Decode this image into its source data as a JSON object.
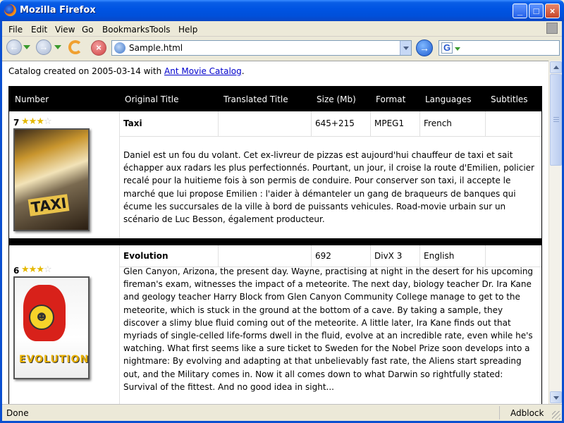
{
  "window": {
    "title": "Mozilla Firefox",
    "buttons": {
      "minimize": "_",
      "maximize": "□",
      "close": "×"
    }
  },
  "menubar": {
    "items": [
      "File",
      "Edit",
      "View",
      "Go",
      "Bookmarks",
      "Tools",
      "Help"
    ]
  },
  "toolbar": {
    "url": "Sample.html",
    "search_engine_icon": "G",
    "search_value": ""
  },
  "page": {
    "intro_prefix": "Catalog created on 2005-03-14 with ",
    "intro_link": "Ant Movie Catalog",
    "intro_suffix": ".",
    "columns": [
      "Number",
      "Original Title",
      "Translated Title",
      "Size (Mb)",
      "Format",
      "Languages",
      "Subtitles"
    ],
    "movies": [
      {
        "number": "7",
        "rating": 3,
        "rating_max": 4,
        "poster_text": "TAXI",
        "original_title": "Taxi",
        "translated_title": "",
        "size": "645+215",
        "format": "MPEG1",
        "languages": "French",
        "subtitles": "",
        "description": "Daniel est un fou du volant. Cet ex-livreur de pizzas est aujourd'hui chauffeur de taxi et sait échapper aux radars les plus perfectionnés. Pourtant, un jour, il croise la route d'Emilien, policier recalé pour la huitieme fois à son permis de conduire. Pour conserver son taxi, il accepte le marché que lui propose Emilien : l'aider à démanteler un gang de braqueurs de banques qui écume les succursales de la ville à bord de puissants vehicules. Road-movie urbain sur un scénario de Luc Besson, également producteur."
      },
      {
        "number": "6",
        "rating": 3,
        "rating_max": 4,
        "poster_text": "EVOLUTION",
        "original_title": "Evolution",
        "translated_title": "",
        "size": "692",
        "format": "DivX 3",
        "languages": "English",
        "subtitles": "",
        "description": "Glen Canyon, Arizona, the present day. Wayne, practising at night in the desert for his upcoming fireman's exam, witnesses the impact of a meteorite. The next day, biology teacher Dr. Ira Kane and geology teacher Harry Block from Glen Canyon Community College manage to get to the meteorite, which is stuck in the ground at the bottom of a cave. By taking a sample, they discover a slimy blue fluid coming out of the meteorite. A little later, Ira Kane finds out that myriads of single-celled life-forms dwell in the fluid, evolve at an incredible rate, even while he's watching. What first seems like a sure ticket to Sweden for the Nobel Prize soon develops into a nightmare: By evolving and adapting at that unbelievably fast rate, the Aliens start spreading out, and the Military comes in. Now it all comes down to what Darwin so rightfully stated: Survival of the fittest. And no good idea in sight..."
      }
    ]
  },
  "statusbar": {
    "status": "Done",
    "adblock": "Adblock"
  },
  "colors": {
    "titlebar": "#0054E3",
    "chrome": "#ECE9D8",
    "header_bg": "#000000",
    "link": "#0000CC",
    "star": "#E5B800"
  }
}
